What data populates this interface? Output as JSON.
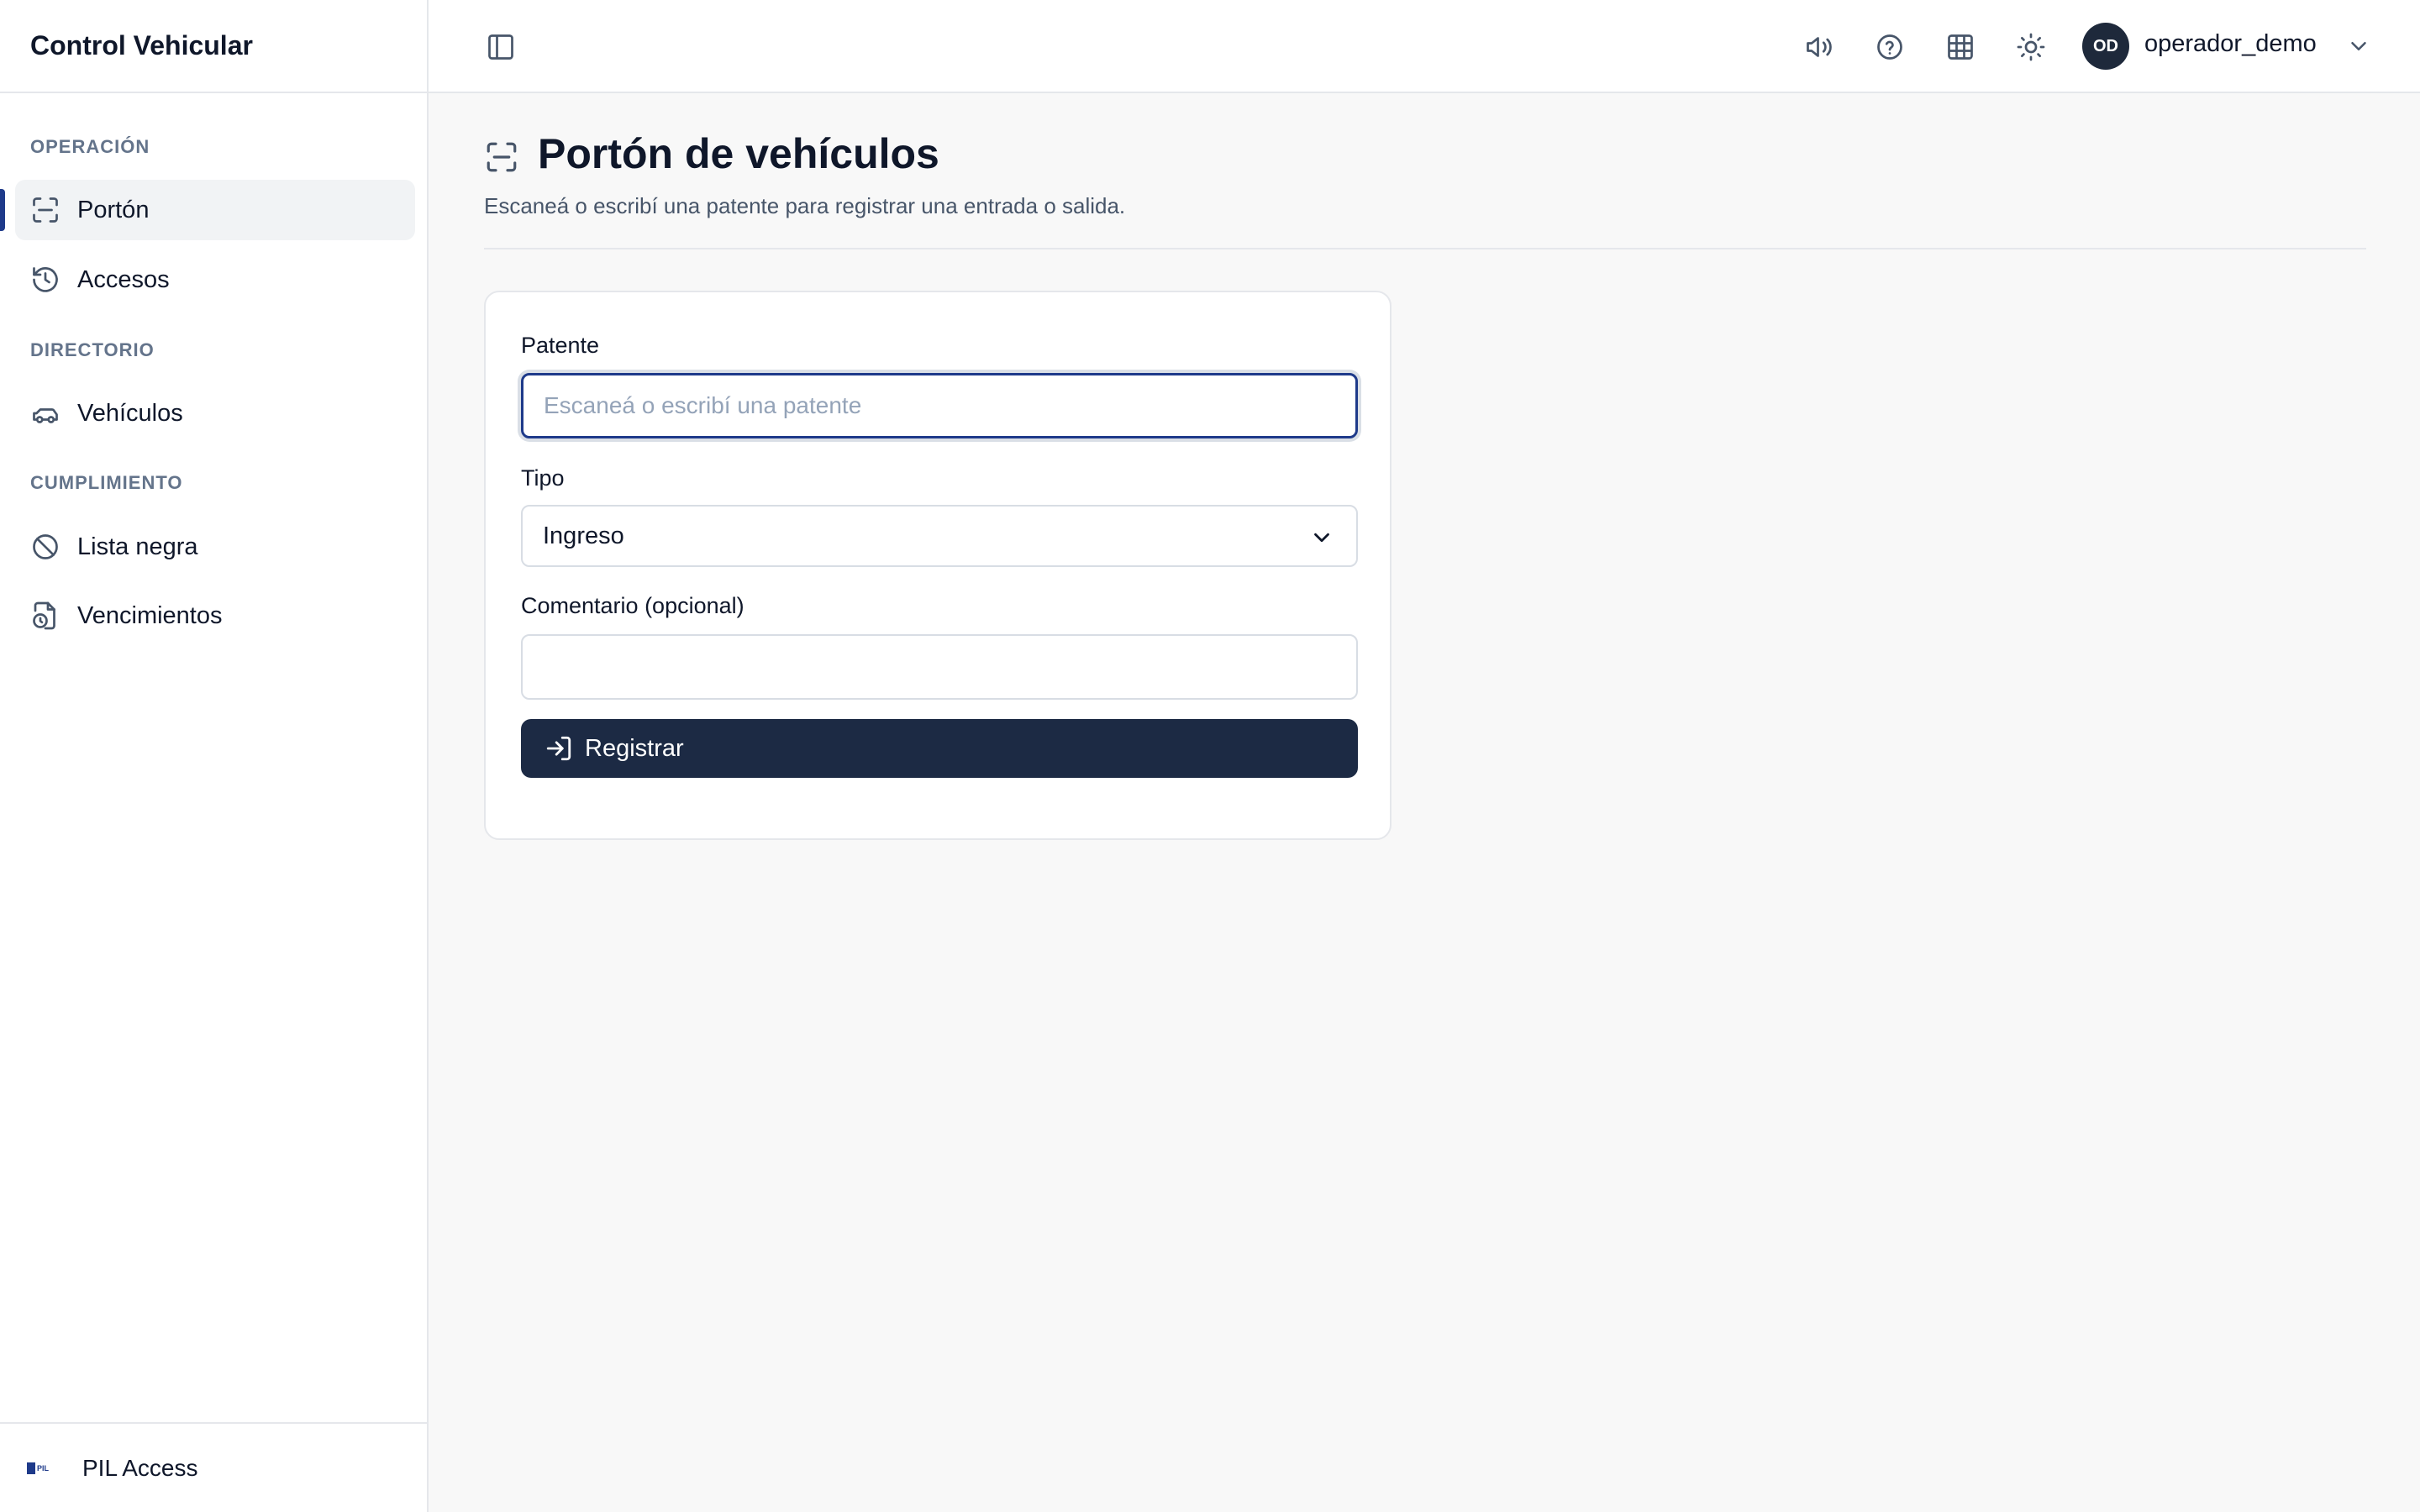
{
  "app": {
    "title": "Control Vehicular"
  },
  "sidebar": {
    "sections": [
      {
        "label": "OPERACIÓN",
        "items": [
          {
            "label": "Portón",
            "icon": "scan-icon",
            "active": true
          },
          {
            "label": "Accesos",
            "icon": "history-icon",
            "active": false
          }
        ]
      },
      {
        "label": "DIRECTORIO",
        "items": [
          {
            "label": "Vehículos",
            "icon": "car-icon",
            "active": false
          }
        ]
      },
      {
        "label": "CUMPLIMIENTO",
        "items": [
          {
            "label": "Lista negra",
            "icon": "ban-icon",
            "active": false
          },
          {
            "label": "Vencimientos",
            "icon": "file-clock-icon",
            "active": false
          }
        ]
      }
    ],
    "footer": {
      "label": "PIL Access",
      "logo_text": "PIL"
    }
  },
  "topbar": {
    "icons": [
      "volume-icon",
      "help-icon",
      "grid-icon",
      "sun-icon"
    ],
    "user": {
      "initials": "OD",
      "name": "operador_demo"
    }
  },
  "page": {
    "title": "Portón de vehículos",
    "subtitle": "Escaneá o escribí una patente para registrar una entrada o salida."
  },
  "form": {
    "patente_label": "Patente",
    "patente_placeholder": "Escaneá o escribí una patente",
    "patente_value": "",
    "tipo_label": "Tipo",
    "tipo_value": "Ingreso",
    "comentario_label": "Comentario (opcional)",
    "comentario_value": "",
    "submit_label": "Registrar"
  },
  "colors": {
    "accent": "#1e3a8a",
    "button_bg": "#1c2a44",
    "avatar_bg": "#1e293b"
  }
}
